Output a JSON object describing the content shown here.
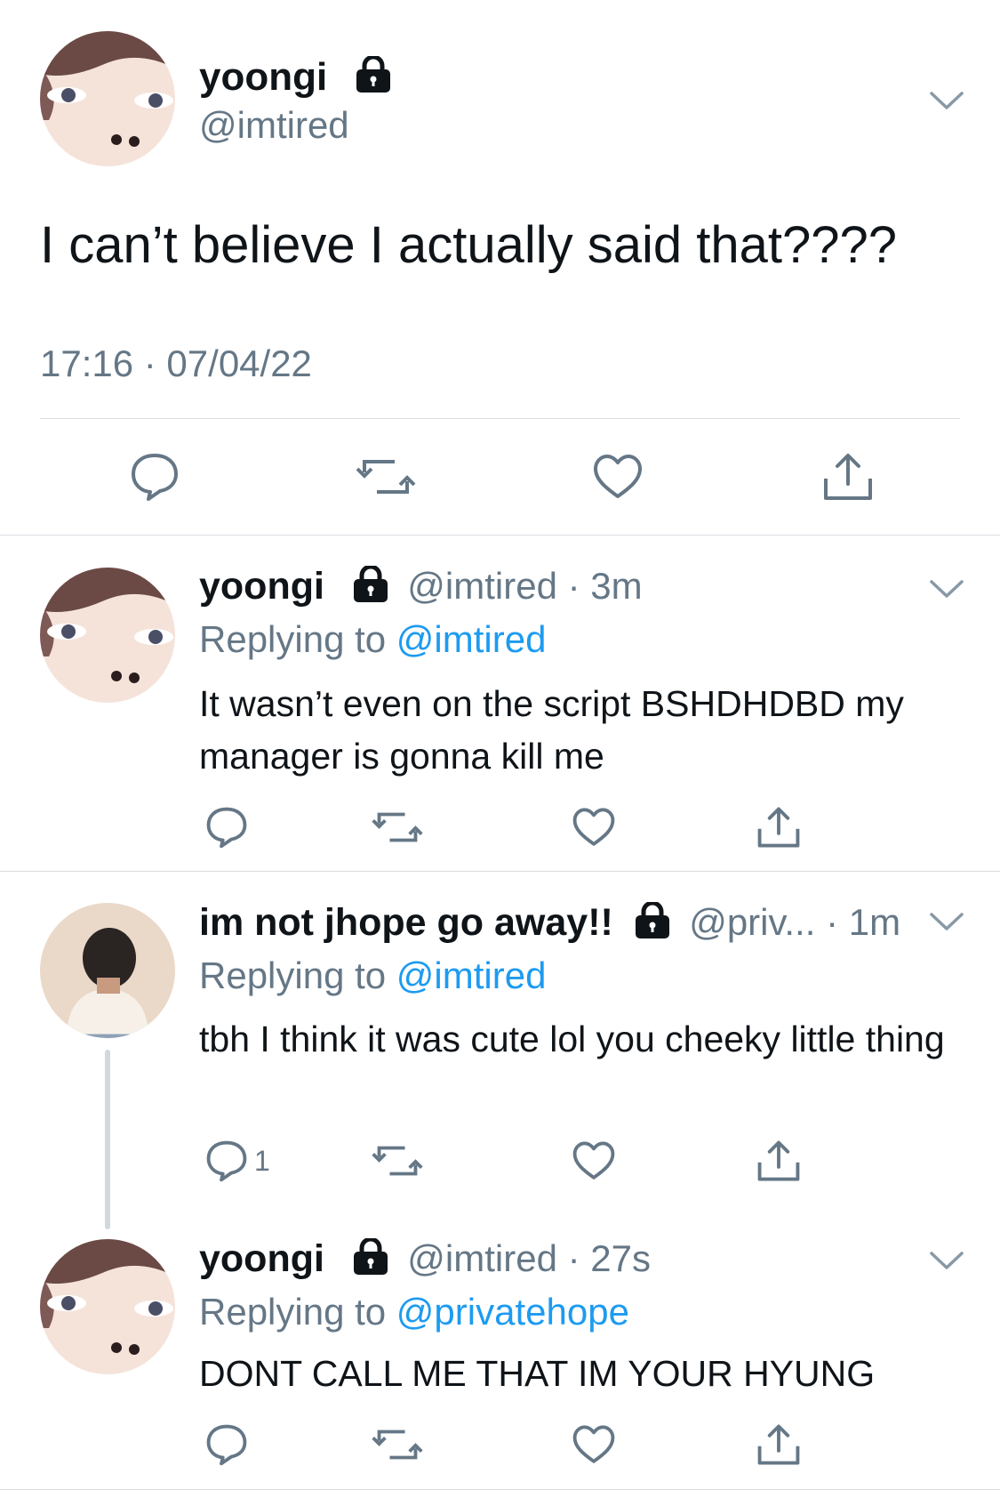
{
  "main_tweet": {
    "name": "yoongi",
    "handle": "@imtired",
    "text": "I can’t believe I actually said that????",
    "timestamp": "17:16 · 07/04/22"
  },
  "replies": [
    {
      "name": "yoongi",
      "handle": "@imtired",
      "time": "· 3m",
      "replying_label": "Replying to",
      "replying_to": "@imtired",
      "text": "It wasn’t even on the script BSHDHDBD my manager is gonna kill me",
      "reply_count": ""
    },
    {
      "name": "im not jhope go away!!",
      "handle": "@priv...",
      "time": "· 1m",
      "replying_label": "Replying to",
      "replying_to": "@imtired",
      "text": "tbh I think it was cute lol you cheeky little thing",
      "reply_count": "1"
    },
    {
      "name": "yoongi",
      "handle": "@imtired",
      "time": "· 27s",
      "replying_label": "Replying to",
      "replying_to": "@privatehope",
      "text": "DONT CALL ME THAT IM YOUR HYUNG",
      "reply_count": ""
    }
  ],
  "icons": {
    "lock": "lock-icon",
    "reply": "reply-bubble-icon",
    "retweet": "retweet-icon",
    "like": "heart-icon",
    "share": "share-icon",
    "more": "chevron-down-icon"
  },
  "colors": {
    "link": "#1d9bf0",
    "muted": "#657786",
    "divider": "#d9dde1"
  }
}
